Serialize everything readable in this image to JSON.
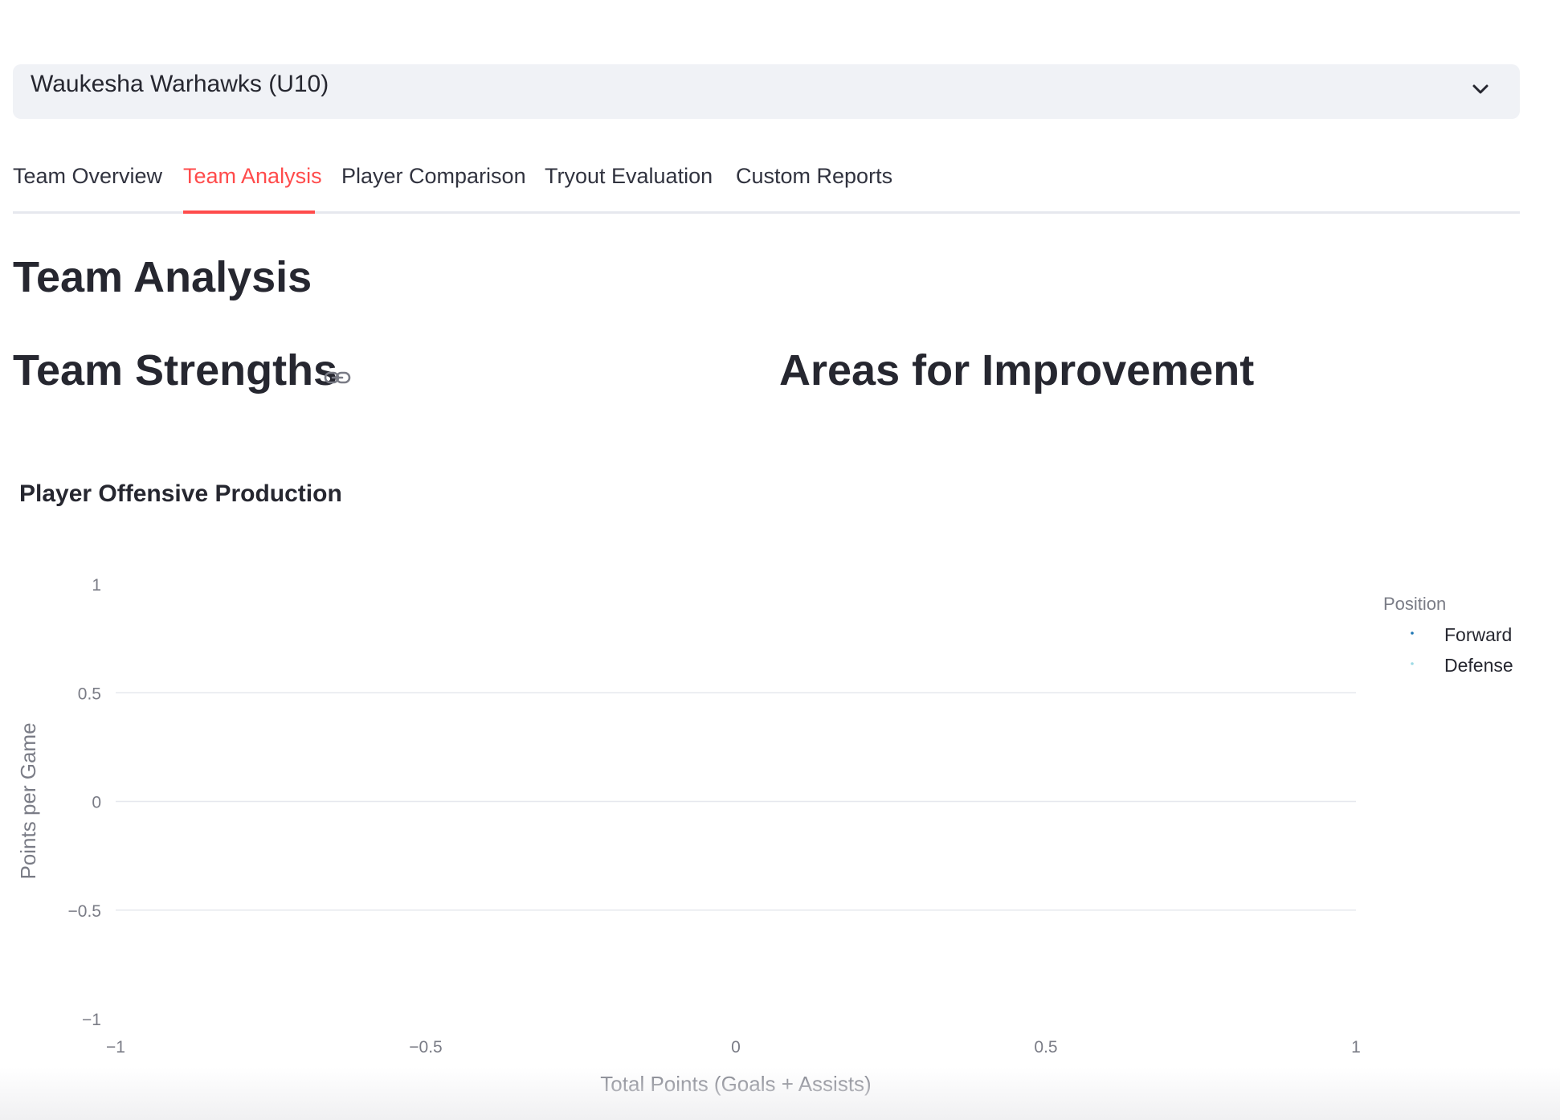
{
  "team_select": {
    "value": "Waukesha Warhawks (U10)",
    "icon": "chevron-down-icon"
  },
  "tabs": [
    {
      "label": "Team Overview",
      "active": false
    },
    {
      "label": "Team Analysis",
      "active": true
    },
    {
      "label": "Player Comparison",
      "active": false
    },
    {
      "label": "Tryout Evaluation",
      "active": false
    },
    {
      "label": "Custom Reports",
      "active": false
    }
  ],
  "colors": {
    "accent": "#ff4b4b",
    "text": "#262730",
    "muted": "#7a7c86",
    "grid": "#e6e8ee",
    "select_bg": "#f0f2f6",
    "forward": "#1f77b4",
    "defense": "#9edae5"
  },
  "page": {
    "title": "Team Analysis",
    "strengths_heading": "Team Strengths",
    "strengths_icon": "link-icon",
    "improvement_heading": "Areas for Improvement"
  },
  "chart_data": {
    "type": "scatter",
    "title": "Player Offensive Production",
    "xlabel": "Total Points (Goals + Assists)",
    "ylabel": "Points per Game",
    "xlim": [
      -1,
      1
    ],
    "ylim": [
      -1,
      1
    ],
    "x_ticks": [
      "−1",
      "−0.5",
      "0",
      "0.5",
      "1"
    ],
    "y_ticks": [
      "1",
      "0.5",
      "0",
      "−0.5",
      "−1"
    ],
    "grid": true,
    "legend": {
      "title": "Position",
      "placement": "top-right",
      "entries": [
        "Forward",
        "Defense"
      ]
    },
    "series": [
      {
        "name": "Forward",
        "x": [],
        "y": []
      },
      {
        "name": "Defense",
        "x": [],
        "y": []
      }
    ]
  }
}
